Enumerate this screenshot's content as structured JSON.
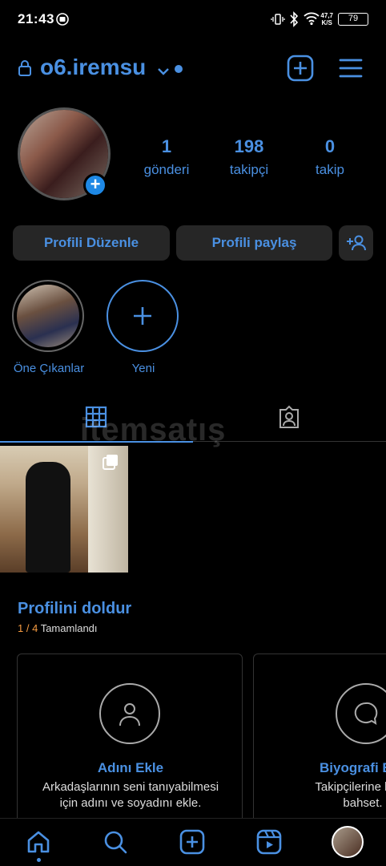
{
  "status_bar": {
    "time": "21:43",
    "speed_value": "47,7",
    "speed_unit": "K/S",
    "battery": "79"
  },
  "header": {
    "username": "o6.iremsu"
  },
  "profile": {
    "stats": [
      {
        "value": "1",
        "label": "gönderi"
      },
      {
        "value": "198",
        "label": "takipçi"
      },
      {
        "value": "0",
        "label": "takip"
      }
    ]
  },
  "actions": {
    "edit_profile": "Profili Düzenle",
    "share_profile": "Profili paylaş"
  },
  "highlights": [
    {
      "label": "Öne Çıkanlar"
    },
    {
      "label": "Yeni"
    }
  ],
  "watermark": "itemsatış",
  "complete_profile": {
    "title": "Profilini doldur",
    "progress_done": "1",
    "progress_sep": " / ",
    "progress_total": "4",
    "progress_label": "Tamamlandı",
    "cards": [
      {
        "title": "Adını Ekle",
        "desc_line1": "Arkadaşlarının seni tanıyabilmesi",
        "desc_line2": "için adını ve soyadını ekle."
      },
      {
        "title": "Biyografi E",
        "desc_line1": "Takipçilerine biraz",
        "desc_line2": "bahset."
      }
    ]
  },
  "colors": {
    "accent": "#4a90e2",
    "background": "#000000",
    "button_bg": "#262626",
    "orange": "#f59b42"
  }
}
